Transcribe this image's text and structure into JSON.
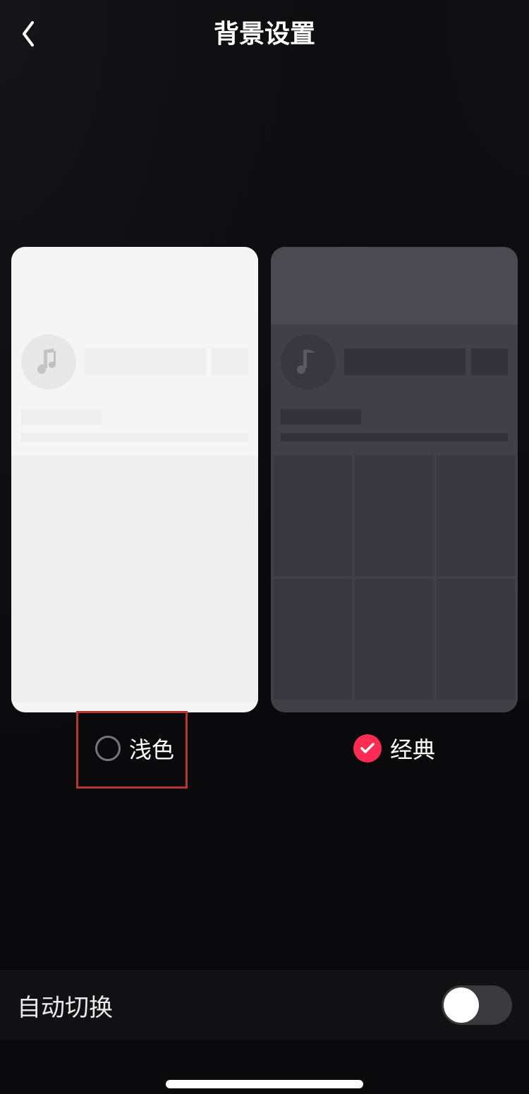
{
  "header": {
    "title": "背景设置"
  },
  "themes": {
    "light": {
      "label": "浅色",
      "selected": false
    },
    "classic": {
      "label": "经典",
      "selected": true
    }
  },
  "autoSwitch": {
    "label": "自动切换",
    "enabled": false
  },
  "icons": {
    "back": "chevron-left",
    "music": "music-note",
    "check": "checkmark"
  },
  "colors": {
    "accent": "#fe2c55",
    "highlight_border": "#b8342f"
  }
}
